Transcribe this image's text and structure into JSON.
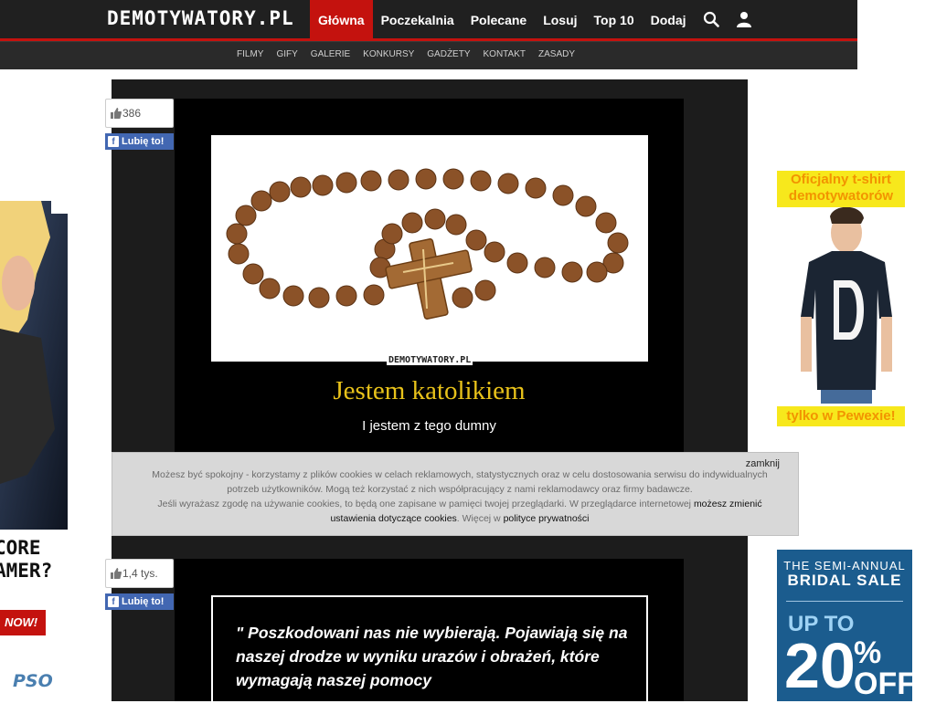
{
  "header": {
    "logo": "DEMOTYWATORY.PL",
    "nav": [
      {
        "label": "Główna",
        "active": true
      },
      {
        "label": "Poczekalnia"
      },
      {
        "label": "Polecane"
      },
      {
        "label": "Losuj"
      },
      {
        "label": "Top 10"
      },
      {
        "label": "Dodaj"
      }
    ],
    "icons": [
      "search-icon",
      "user-icon"
    ],
    "subnav": [
      "FILMY",
      "GIFY",
      "GALERIE",
      "KONKURSY",
      "GADŻETY",
      "KONTAKT",
      "ZASADY"
    ],
    "accent": "#c4120e"
  },
  "posts": [
    {
      "likes": "386",
      "fb_label": "Lubię to!",
      "watermark": "DEMOTYWATORY.PL",
      "title": "Jestem katolikiem",
      "subtitle": "I jestem z tego dumny",
      "title_color": "#e8c21a"
    },
    {
      "likes": "1,4 tys.",
      "fb_label": "Lubię to!",
      "quote": "\" Poszkodowani nas nie wybierają. Pojawiają się na naszej drodze w wyniku urazów i obrażeń, które wymagają naszej pomocy"
    }
  ],
  "cookie_banner": {
    "close": "zamknij",
    "text1": "Możesz być spokojny - korzystamy z plików cookies w celach reklamowych, statystycznych oraz w celu dostosowania serwisu do indywidualnych potrzeb użytkowników. Mogą też korzystać z nich współpracujący z nami reklamodawcy oraz firmy badawcze.",
    "text2": "Jeśli wyrażasz zgodę na używanie cookies, to będą one zapisane w pamięci twojej przeglądarki. W przeglądarce internetowej",
    "link1": "możesz zmienić ustawienia dotyczące cookies",
    "text3": ". Więcej w",
    "link2": "polityce prywatności"
  },
  "ads": {
    "left": {
      "line1": "CORE",
      "line2": "AMER?",
      "button": "NOW!",
      "logo": "PSO"
    },
    "right_tshirt": {
      "top1": "Oficjalny t-shirt",
      "top2": "demotywatorów",
      "bottom": "tylko w Pewexie!"
    },
    "right_sale": {
      "line1": "THE SEMI-ANNUAL",
      "line2": "BRIDAL SALE",
      "line3": "UP TO",
      "line4": "20",
      "line5": "% OFF"
    }
  }
}
